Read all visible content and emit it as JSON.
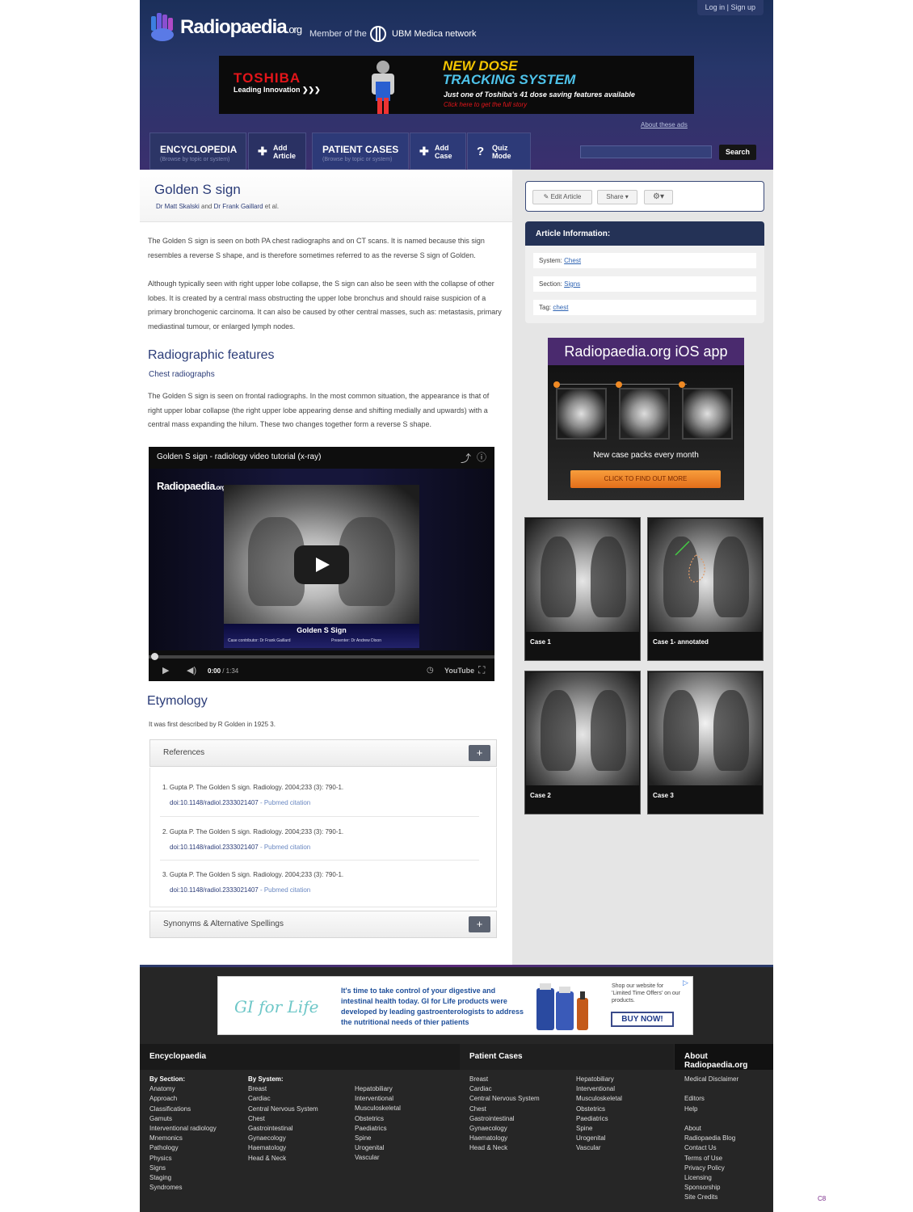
{
  "header": {
    "logo": "Radiopaedia",
    "logo_suffix": ".org",
    "member_text": "Member of the",
    "network_text": "UBM Medica network",
    "login": "Log in",
    "signup": "Sign up",
    "about_ads": "About these ads"
  },
  "top_ad": {
    "brand": "TOSHIBA",
    "tagline": "Leading Innovation",
    "headline1": "NEW DOSE",
    "headline2": "TRACKING SYSTEM",
    "line1": "Just one of Toshiba's 41 dose saving features available",
    "line2": "Click here to get the full story",
    "colors": {
      "brand": "#e3151a",
      "headline1": "#f3c400",
      "headline2": "#4ec3ea"
    }
  },
  "nav": {
    "encyclopedia": "ENCYCLOPEDIA",
    "encyclopedia_sub": "(Browse by topic or system)",
    "add_article": [
      "Add",
      "Article"
    ],
    "patient_cases": "PATIENT CASES",
    "patient_cases_sub": "(Browse by topic or system)",
    "add_case": [
      "Add",
      "Case"
    ],
    "quiz_mode": [
      "Quiz",
      "Mode"
    ],
    "search_button": "Search"
  },
  "article": {
    "title": "Golden S sign",
    "author1": "Dr Matt Skalski",
    "and": "and",
    "author2": "Dr Frank Gaillard",
    "etal": "et al.",
    "p1": "The Golden S sign is seen on both PA chest radiographs and on CT scans. It is named because this sign resembles a reverse S shape, and is therefore sometimes referred to as the reverse S sign of Golden.",
    "p2": "Although typically seen with right upper lobe collapse, the S sign can also be seen with the collapse of other lobes. It is created by a central mass obstructing the upper lobe bronchus and should raise suspicion of a primary bronchogenic carcinoma. It can also be caused by other central masses, such as: metastasis, primary mediastinal tumour, or enlarged lymph nodes.",
    "h_radiographic": "Radiographic features",
    "h_chest": "Chest radiographs",
    "p3": "The Golden S sign is seen on frontal radiographs. In the most common situation, the appearance is that of right upper lobar collapse (the right upper lobe appearing dense and shifting medially and upwards) with a central mass expanding the hilum. These two changes together form a reverse S shape.",
    "h_etymology": "Etymology",
    "etymology_text": "It was first described by R Golden in 1925 3."
  },
  "video": {
    "title": "Golden S sign - radiology video tutorial (x-ray)",
    "logo": "Radiopaedia",
    "logo_suffix": ".org",
    "caption": "Golden S Sign",
    "credit1": "Case contributor: Dr Frank Gaillard",
    "credit2": "Presenter: Dr Andrew Dixon",
    "time_current": "0:00",
    "time_total": " / 1:34",
    "youtube": "YouTube",
    "progress": 0
  },
  "references": {
    "label": "References",
    "items": [
      {
        "text": "1. Gupta P. The Golden S sign. Radiology. 2004;233 (3): 790-1.",
        "doi": "doi:10.1148/radiol.2333021407",
        "pubmed": " - Pubmed citation"
      },
      {
        "text": "2. Gupta P. The Golden S sign. Radiology. 2004;233 (3): 790-1.",
        "doi": "doi:10.1148/radiol.2333021407",
        "pubmed": " - Pubmed citation"
      },
      {
        "text": "3. Gupta P. The Golden S sign. Radiology. 2004;233 (3): 790-1.",
        "doi": "doi:10.1148/radiol.2333021407",
        "pubmed": " - Pubmed citation"
      }
    ]
  },
  "synonyms": {
    "label": "Synonyms & Alternative Spellings"
  },
  "toolbar": {
    "edit": "Edit Article",
    "share": "Share",
    "settings": "⚙"
  },
  "article_info": {
    "title": "Article Information:",
    "system_label": "System:",
    "system_value": "Chest",
    "section_label": "Section:",
    "section_value": "Signs",
    "tag_label": "Tag:",
    "tag_value": "chest"
  },
  "ios_ad": {
    "title": "Radiopaedia.org iOS app",
    "text": "New case packs every month",
    "button": "CLICK TO FIND OUT MORE"
  },
  "cases": [
    {
      "label": "Case 1"
    },
    {
      "label": "Case 1- annotated"
    },
    {
      "label": "Case 2"
    },
    {
      "label": "Case 3"
    }
  ],
  "footer_ad": {
    "logo": "GI for Life",
    "text": "It's time to take control of your digestive and intestinal health today. GI for Life products were developed by leading gastroenterologists to address the nutritional needs of thier patients",
    "shop": "Shop our website for 'Limited Time Offers' on our products.",
    "button": "BUY NOW!"
  },
  "footer": {
    "encyclopedia": "Encyclopaedia",
    "patient_cases": "Patient Cases",
    "about": "About Radiopaedia.org",
    "by_section": "By Section:",
    "sections": [
      "Anatomy",
      "Approach",
      "Classifications",
      "Gamuts",
      "Interventional radiology",
      "Mnemonics",
      "Pathology",
      "Physics",
      "Signs",
      "Staging",
      "Syndromes"
    ],
    "by_system": "By System:",
    "systems_a": [
      "Breast",
      "Cardiac",
      "Central Nervous System",
      "Chest",
      "Gastrointestinal",
      "Gynaecology",
      "Haematology",
      "Head & Neck"
    ],
    "systems_b": [
      "Hepatobiliary",
      "Interventional",
      "Musculoskeletal",
      "Obstetrics",
      "Paediatrics",
      "Spine",
      "Urogenital",
      "Vascular"
    ],
    "cases_a": [
      "Breast",
      "Cardiac",
      "Central Nervous System",
      "Chest",
      "Gastrointestinal",
      "Gynaecology",
      "Haematology",
      "Head & Neck"
    ],
    "cases_b": [
      "Hepatobiliary",
      "Interventional",
      "Musculoskeletal",
      "Obstetrics",
      "Paediatrics",
      "Spine",
      "Urogenital",
      "Vascular"
    ],
    "about_links": [
      "Medical Disclaimer",
      "",
      "Editors",
      "Help",
      "",
      "About",
      "Radiopaedia Blog",
      "Contact Us",
      "Terms of Use",
      "Privacy Policy",
      "Licensing",
      "Sponsorship",
      "Site Credits"
    ]
  },
  "corner_label": "C8"
}
